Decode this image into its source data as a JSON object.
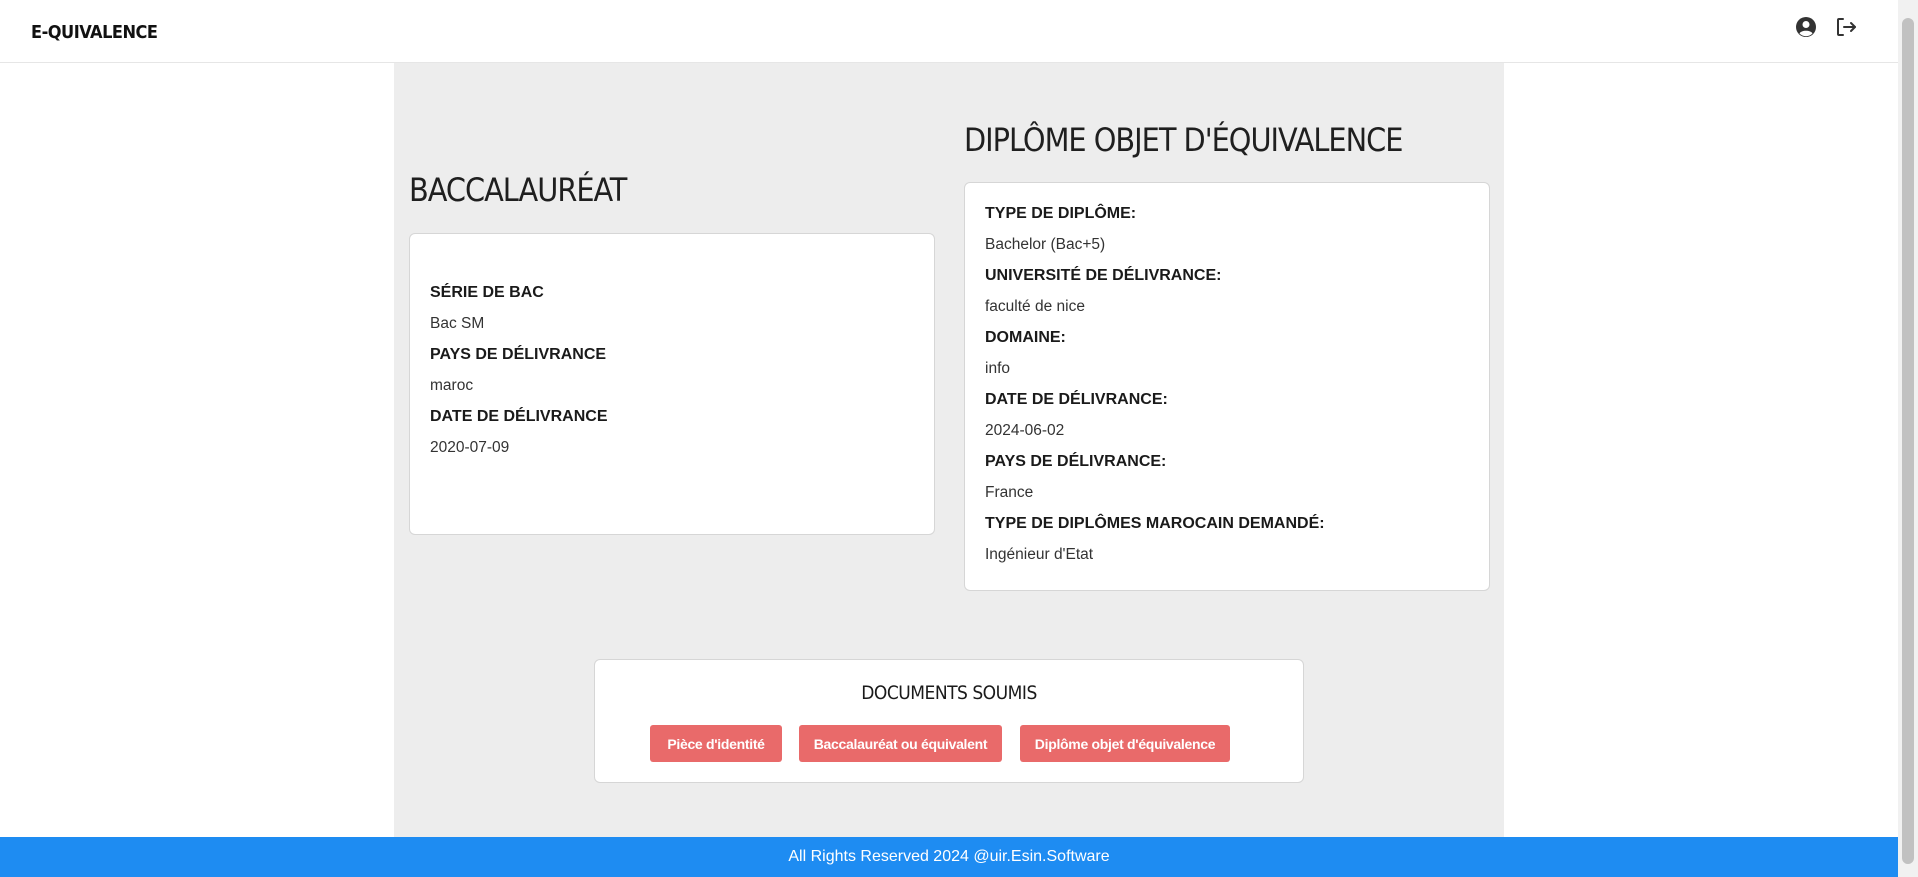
{
  "navbar": {
    "brand": "E-QUIVALENCE",
    "icons": [
      "user-circle-icon",
      "logout-icon"
    ]
  },
  "bac": {
    "title": "BACCALAURÉAT",
    "fields": [
      {
        "label": "SÉRIE DE BAC",
        "value": "Bac SM"
      },
      {
        "label": "PAYS DE DÉLIVRANCE",
        "value": "maroc"
      },
      {
        "label": "DATE DE DÉLIVRANCE",
        "value": "2020-07-09"
      }
    ]
  },
  "diplome": {
    "title": "DIPLÔME OBJET D'ÉQUIVALENCE",
    "fields": [
      {
        "label": "TYPE DE DIPLÔME:",
        "value": "Bachelor (Bac+5)"
      },
      {
        "label": "UNIVERSITÉ DE DÉLIVRANCE:",
        "value": "faculté de nice"
      },
      {
        "label": "DOMAINE:",
        "value": "info"
      },
      {
        "label": "DATE DE DÉLIVRANCE:",
        "value": "2024-06-02"
      },
      {
        "label": "PAYS DE DÉLIVRANCE:",
        "value": "France"
      },
      {
        "label": "TYPE DE DIPLÔMES MAROCAIN DEMANDÉ:",
        "value": "Ingénieur d'Etat"
      }
    ]
  },
  "documents": {
    "title": "DOCUMENTS SOUMIS",
    "buttons": [
      "Pièce d'identité",
      "Baccalauréat ou équivalent",
      "Diplôme objet d'équivalence"
    ]
  },
  "footer": {
    "text": "All Rights Reserved 2024 @uir.Esin.Software"
  },
  "colors": {
    "accent": "#1e8cf2",
    "button": "#e96a6a",
    "panel_background": "#ededed"
  }
}
